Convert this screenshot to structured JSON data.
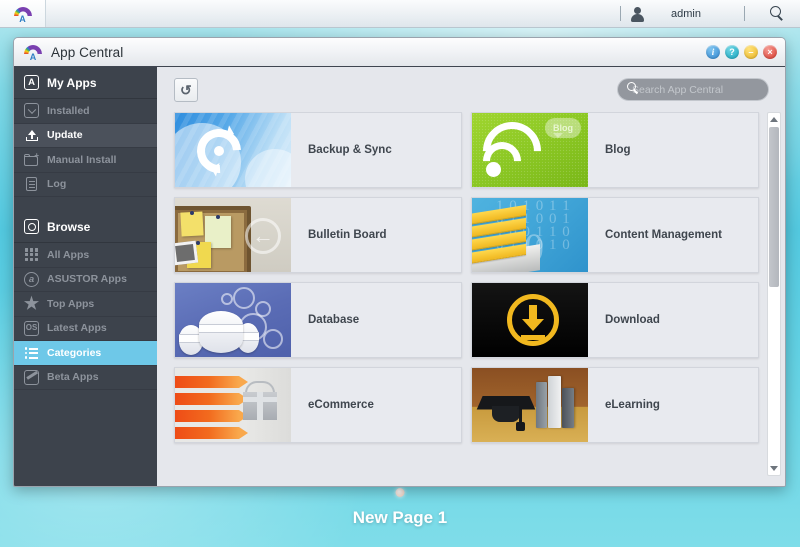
{
  "topbar": {
    "logo_icon": "app-central-rainbow-icon",
    "user_icon": "user-icon",
    "username": "admin",
    "search_icon": "search-icon"
  },
  "window": {
    "title": "App Central",
    "title_icon": "app-central-rainbow-icon",
    "buttons": [
      {
        "name": "info-button",
        "glyph": "i",
        "color": "#2f86d2"
      },
      {
        "name": "help-button",
        "glyph": "?",
        "color": "#16a6c0"
      },
      {
        "name": "minimize-button",
        "glyph": "–",
        "color": "#e9b321"
      },
      {
        "name": "close-button",
        "glyph": "×",
        "color": "#d9372a"
      }
    ]
  },
  "sidebar": {
    "sections": [
      {
        "header": {
          "label": "My Apps",
          "icon": "my-apps-icon"
        },
        "items": [
          {
            "label": "Installed",
            "icon": "installed-icon",
            "state": "normal"
          },
          {
            "label": "Update",
            "icon": "update-icon",
            "state": "hover"
          },
          {
            "label": "Manual Install",
            "icon": "manual-install-icon",
            "state": "normal"
          },
          {
            "label": "Log",
            "icon": "log-icon",
            "state": "normal"
          }
        ]
      },
      {
        "header": {
          "label": "Browse",
          "icon": "browse-icon"
        },
        "items": [
          {
            "label": "All Apps",
            "icon": "grid-icon",
            "state": "normal"
          },
          {
            "label": "ASUSTOR Apps",
            "icon": "asustor-icon",
            "state": "normal"
          },
          {
            "label": "Top Apps",
            "icon": "star-icon",
            "state": "normal"
          },
          {
            "label": "Latest Apps",
            "icon": "latest-apps-icon",
            "state": "normal"
          },
          {
            "label": "Categories",
            "icon": "list-icon",
            "state": "selected"
          },
          {
            "label": "Beta Apps",
            "icon": "beta-icon",
            "state": "normal"
          }
        ]
      }
    ]
  },
  "toolbar": {
    "refresh_icon": "refresh-icon",
    "refresh_glyph": "↻",
    "search": {
      "icon": "search-icon",
      "value": "",
      "placeholder": "Search App Central"
    }
  },
  "categories": [
    {
      "name": "Backup & Sync",
      "thumb": "backup-sync-thumbnail"
    },
    {
      "name": "Blog",
      "thumb": "blog-thumbnail",
      "badge": "Blog"
    },
    {
      "name": "Bulletin Board",
      "thumb": "bulletin-board-thumbnail"
    },
    {
      "name": "Content Management",
      "thumb": "content-management-thumbnail"
    },
    {
      "name": "Database",
      "thumb": "database-thumbnail"
    },
    {
      "name": "Download",
      "thumb": "download-thumbnail"
    },
    {
      "name": "eCommerce",
      "thumb": "ecommerce-thumbnail"
    },
    {
      "name": "eLearning",
      "thumb": "elearning-thumbnail"
    }
  ],
  "scrollbar": {
    "up_icon": "scroll-up-arrow-icon",
    "down_icon": "scroll-down-arrow-icon",
    "thumb_position_percent": 2,
    "thumb_size_percent": 45
  },
  "desktop": {
    "page_label": "New Page 1",
    "page_indicator": "page-dot-indicator"
  },
  "colors": {
    "accent_selected": "#6ec8e8",
    "sidebar_bg": "#3d434c",
    "desktop_bg": "#53c9e0"
  }
}
